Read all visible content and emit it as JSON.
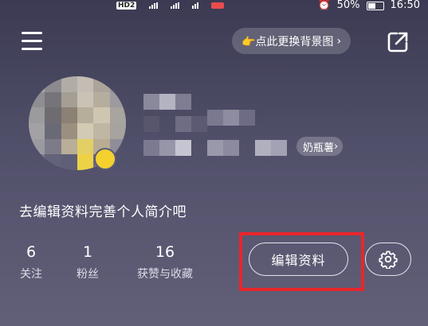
{
  "status_bar": {
    "badge": "HD",
    "badge_sub": "2",
    "battery_percent": "50%",
    "time": "16:50"
  },
  "header": {
    "menu_icon": "hamburger-menu-icon",
    "change_bg_label": "👉点此更换背景图",
    "change_bg_chevron": "›",
    "share_icon": "share-external-icon"
  },
  "profile": {
    "avatar_icon": "avatar",
    "tag_label": "奶瓶薯",
    "tag_chevron": "›",
    "bio_prompt": "去编辑资料完善个人简介吧"
  },
  "stats": [
    {
      "value": "6",
      "label": "关注"
    },
    {
      "value": "1",
      "label": "粉丝"
    },
    {
      "value": "16",
      "label": "获赞与收藏"
    }
  ],
  "actions": {
    "edit_profile_label": "编辑资料",
    "settings_icon": "gear-icon",
    "highlight_color": "#e8262c"
  },
  "colors": {
    "background_top": "#3b3a52",
    "background_bottom": "#625f78"
  }
}
